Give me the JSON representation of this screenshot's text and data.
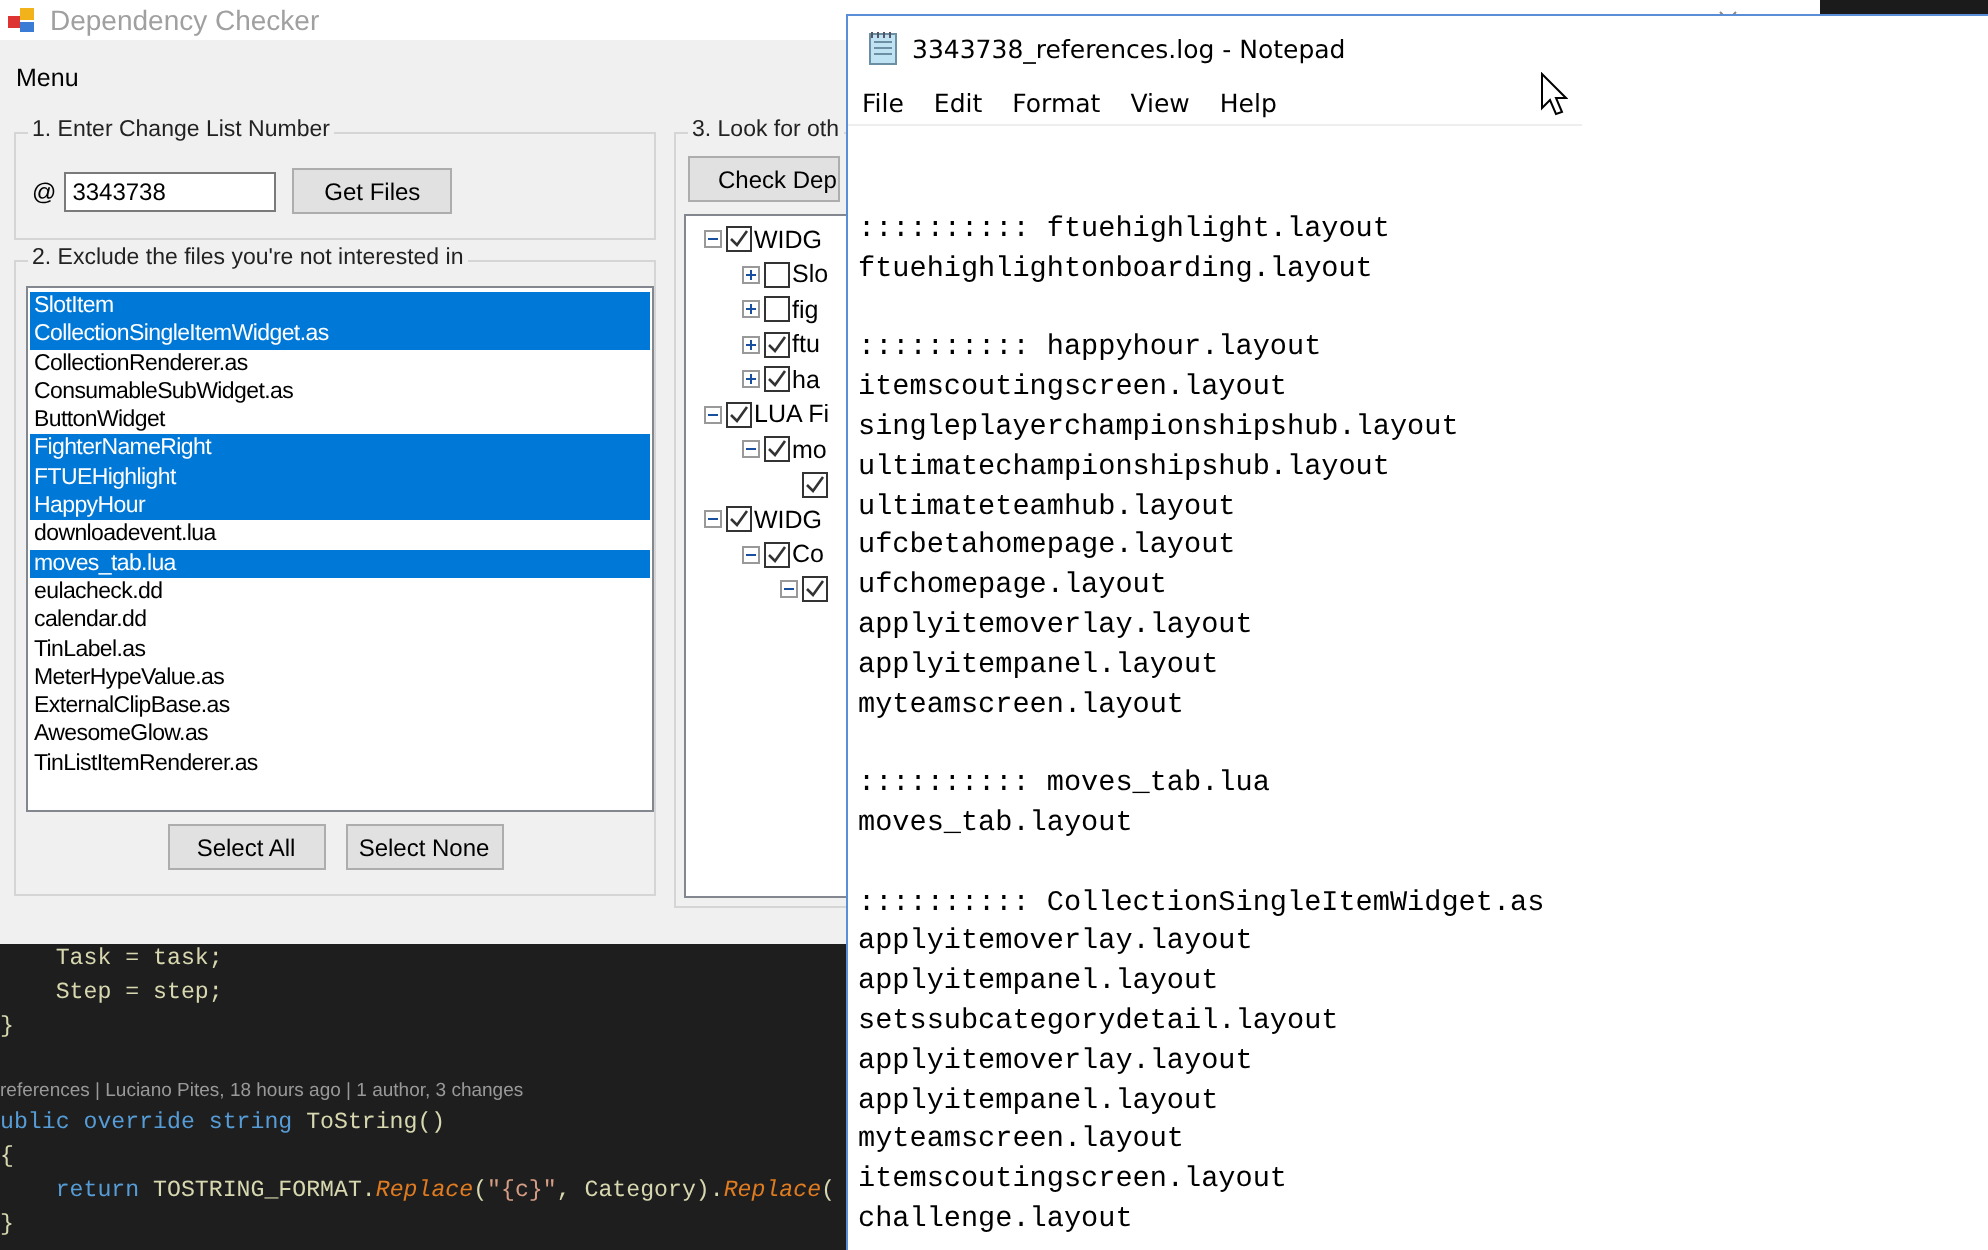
{
  "app_window": {
    "title": "Dependency Checker",
    "menu": "Menu",
    "step1": {
      "title": "1. Enter Change List Number",
      "prefix": "@",
      "value": "3343738",
      "button": "Get Files"
    },
    "step2": {
      "title": "2. Exclude the files you're not interested in",
      "buttons": [
        "Select All",
        "Select None"
      ],
      "files": [
        {
          "name": "SlotItem",
          "selected": true
        },
        {
          "name": "CollectionSingleItemWidget.as",
          "selected": true
        },
        {
          "name": "CollectionRenderer.as",
          "selected": false
        },
        {
          "name": "ConsumableSubWidget.as",
          "selected": false
        },
        {
          "name": "ButtonWidget",
          "selected": false
        },
        {
          "name": "FighterNameRight",
          "selected": true
        },
        {
          "name": "FTUEHighlight",
          "selected": true
        },
        {
          "name": "HappyHour",
          "selected": true
        },
        {
          "name": "downloadevent.lua",
          "selected": false
        },
        {
          "name": "moves_tab.lua",
          "selected": true
        },
        {
          "name": "eulacheck.dd",
          "selected": false
        },
        {
          "name": "calendar.dd",
          "selected": false
        },
        {
          "name": "TinLabel.as",
          "selected": false
        },
        {
          "name": "MeterHypeValue.as",
          "selected": false
        },
        {
          "name": "ExternalClipBase.as",
          "selected": false
        },
        {
          "name": "AwesomeGlow.as",
          "selected": false
        },
        {
          "name": "TinListItemRenderer.as",
          "selected": false
        }
      ]
    },
    "step3": {
      "title": "3. Look for oth",
      "button": "Check Dep",
      "tree": [
        {
          "label": "WIDG",
          "checked": true,
          "expanded": true,
          "children": [
            {
              "label": "Slo",
              "checked": false,
              "expanded": false
            },
            {
              "label": "fig",
              "checked": false,
              "expanded": false
            },
            {
              "label": "ftu",
              "checked": true,
              "expanded": false
            },
            {
              "label": "ha",
              "checked": true,
              "expanded": false
            }
          ]
        },
        {
          "label": "LUA Fi",
          "checked": true,
          "expanded": true,
          "children": [
            {
              "label": "mo",
              "checked": true,
              "expanded": true,
              "children": [
                {
                  "checked": true
                }
              ]
            }
          ]
        },
        {
          "label": "WIDG",
          "checked": true,
          "expanded": true,
          "children": [
            {
              "label": "Co",
              "checked": true,
              "expanded": true,
              "children": [
                {
                  "checked": true,
                  "expanded": true
                }
              ]
            }
          ]
        }
      ]
    }
  },
  "code_editor": {
    "lines": [
      [
        {
          "text": "    Task = task;",
          "kind": "plain"
        }
      ],
      [
        {
          "text": "    Step = step;",
          "kind": "plain"
        }
      ],
      [
        {
          "text": "}",
          "kind": "plain"
        }
      ],
      [
        {
          "text": "references | Luciano Pites, 18 hours ago | 1 author, 3 changes",
          "kind": "lens"
        }
      ],
      [
        {
          "text": "ublic override string",
          "kind": "keyword"
        },
        {
          "text": " ToString()",
          "kind": "plain"
        }
      ],
      [
        {
          "text": "{",
          "kind": "plain"
        }
      ],
      [
        {
          "text": "    return",
          "kind": "keyword"
        },
        {
          "text": " TOSTRING_FORMAT.",
          "kind": "plain"
        },
        {
          "text": "Replace",
          "kind": "method"
        },
        {
          "text": "(",
          "kind": "plain"
        },
        {
          "text": "\"{c}\"",
          "kind": "string"
        },
        {
          "text": ", Category).",
          "kind": "plain"
        },
        {
          "text": "Replace",
          "kind": "method"
        },
        {
          "text": "(",
          "kind": "plain"
        }
      ],
      [
        {
          "text": "}",
          "kind": "plain"
        }
      ]
    ]
  },
  "notepad": {
    "title": "3343738_references.log - Notepad",
    "menu": [
      "File",
      "Edit",
      "Format",
      "View",
      "Help"
    ],
    "blocks": [
      {
        "header": ":::::::::: ftuehighlight.layout",
        "lines": [
          "ftuehighlightonboarding.layout"
        ]
      },
      {
        "header": ":::::::::: happyhour.layout",
        "lines": [
          "itemscoutingscreen.layout",
          "singleplayerchampionshipshub.layout",
          "ultimatechampionshipshub.layout",
          "ultimateteamhub.layout",
          "ufcbetahomepage.layout",
          "ufchomepage.layout",
          "applyitemoverlay.layout",
          "applyitempanel.layout",
          "myteamscreen.layout"
        ]
      },
      {
        "header": ":::::::::: moves_tab.lua",
        "lines": [
          "moves_tab.layout"
        ]
      },
      {
        "header": ":::::::::: CollectionSingleItemWidget.as",
        "lines": [
          "applyitemoverlay.layout",
          "applyitempanel.layout",
          "setssubcategorydetail.layout",
          "applyitemoverlay.layout",
          "applyitempanel.layout",
          "myteamscreen.layout",
          "itemscoutingscreen.layout",
          "challenge.layout"
        ]
      }
    ]
  }
}
